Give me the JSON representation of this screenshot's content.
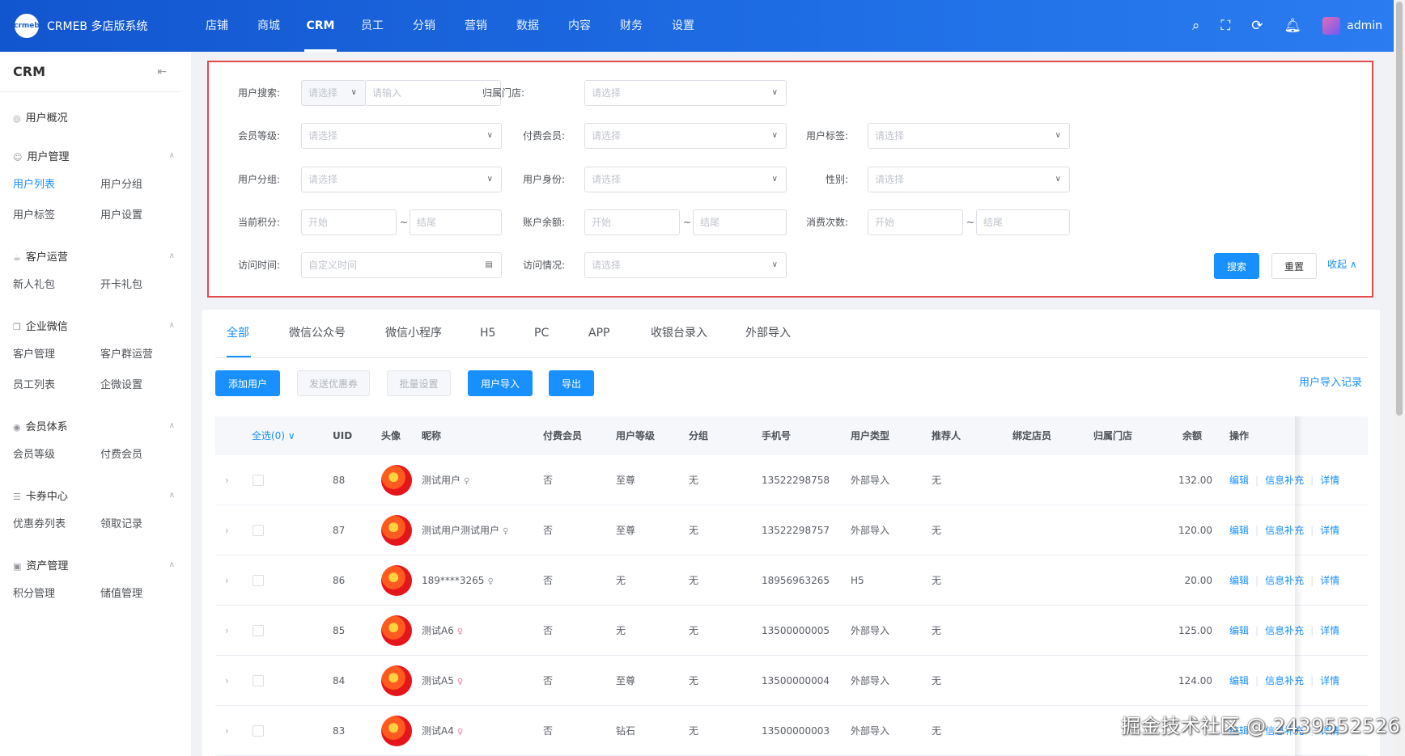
{
  "header": {
    "logo_mark": "crmeb",
    "app_title": "CRMEB 多店版系统",
    "nav": [
      "店铺",
      "商城",
      "CRM",
      "员工",
      "分销",
      "营销",
      "数据",
      "内容",
      "财务",
      "设置"
    ],
    "active_nav": "CRM",
    "user": "admin"
  },
  "sidebar": {
    "title": "CRM",
    "overview": "用户概况",
    "sections": [
      {
        "title": "用户管理",
        "items": [
          "用户列表",
          "用户分组",
          "用户标签",
          "用户设置"
        ]
      },
      {
        "title": "客户运营",
        "items": [
          "新人礼包",
          "开卡礼包"
        ]
      },
      {
        "title": "企业微信",
        "items": [
          "客户管理",
          "客户群运营",
          "员工列表",
          "企微设置"
        ]
      },
      {
        "title": "会员体系",
        "items": [
          "会员等级",
          "付费会员"
        ]
      },
      {
        "title": "卡券中心",
        "items": [
          "优惠券列表",
          "领取记录"
        ]
      },
      {
        "title": "资产管理",
        "items": [
          "积分管理",
          "储值管理"
        ]
      }
    ],
    "active_item": "用户列表"
  },
  "filter": {
    "user_search_label": "用户搜索:",
    "user_search_select": "请选择",
    "user_search_input": "请输入",
    "store_label": "归属门店:",
    "member_level_label": "会员等级:",
    "paid_member_label": "付费会员:",
    "user_tag_label": "用户标签:",
    "user_group_label": "用户分组:",
    "user_identity_label": "用户身份:",
    "gender_label": "性别:",
    "points_label": "当前积分:",
    "balance_label": "账户余额:",
    "consume_label": "消费次数:",
    "visit_time_label": "访问时间:",
    "visit_status_label": "访问情况:",
    "select_placeholder": "请选择",
    "start_placeholder": "开始",
    "end_placeholder": "结尾",
    "range_sep": "~",
    "date_placeholder": "自定义时间",
    "search_btn": "搜索",
    "reset_btn": "重置",
    "collapse_link": "收起"
  },
  "tabs": [
    "全部",
    "微信公众号",
    "微信小程序",
    "H5",
    "PC",
    "APP",
    "收银台录入",
    "外部导入"
  ],
  "toolbar": {
    "add_user": "添加用户",
    "send_coupon": "发送优惠券",
    "batch_set": "批量设置",
    "import_user": "用户导入",
    "export": "导出",
    "import_log": "用户导入记录"
  },
  "table": {
    "headers": {
      "select_all": "全选(0)",
      "uid": "UID",
      "avatar": "头像",
      "nickname": "昵称",
      "paid": "付费会员",
      "level": "用户等级",
      "group": "分组",
      "phone": "手机号",
      "type": "用户类型",
      "referrer": "推荐人",
      "bind_clerk": "绑定店员",
      "store": "归属门店",
      "balance": "余额",
      "ops": "操作"
    },
    "ops_labels": {
      "edit": "编辑",
      "info": "信息补充",
      "detail": "详情"
    },
    "rows": [
      {
        "uid": "88",
        "nickname": "测试用户",
        "gender": "unknown",
        "paid": "否",
        "level": "至尊",
        "group": "无",
        "phone": "13522298758",
        "type": "外部导入",
        "referrer": "无",
        "balance": "132.00"
      },
      {
        "uid": "87",
        "nickname": "测试用户测试用户",
        "gender": "unknown",
        "paid": "否",
        "level": "至尊",
        "group": "无",
        "phone": "13522298757",
        "type": "外部导入",
        "referrer": "无",
        "balance": "120.00"
      },
      {
        "uid": "86",
        "nickname": "189****3265",
        "gender": "unknown",
        "paid": "否",
        "level": "无",
        "group": "无",
        "phone": "18956963265",
        "type": "H5",
        "referrer": "无",
        "balance": "20.00"
      },
      {
        "uid": "85",
        "nickname": "测试A6",
        "gender": "female",
        "paid": "否",
        "level": "无",
        "group": "无",
        "phone": "13500000005",
        "type": "外部导入",
        "referrer": "无",
        "balance": "125.00"
      },
      {
        "uid": "84",
        "nickname": "测试A5",
        "gender": "female",
        "paid": "否",
        "level": "至尊",
        "group": "无",
        "phone": "13500000004",
        "type": "外部导入",
        "referrer": "无",
        "balance": "124.00"
      },
      {
        "uid": "83",
        "nickname": "测试A4",
        "gender": "female",
        "paid": "否",
        "level": "钻石",
        "group": "无",
        "phone": "13500000003",
        "type": "外部导入",
        "referrer": "无",
        "balance": ""
      }
    ]
  },
  "watermark": "掘金技术社区 @ 2439552526",
  "colors": {
    "primary": "#1890ff",
    "header": "#1a5fd6",
    "highlight_border": "#e34a4a"
  }
}
